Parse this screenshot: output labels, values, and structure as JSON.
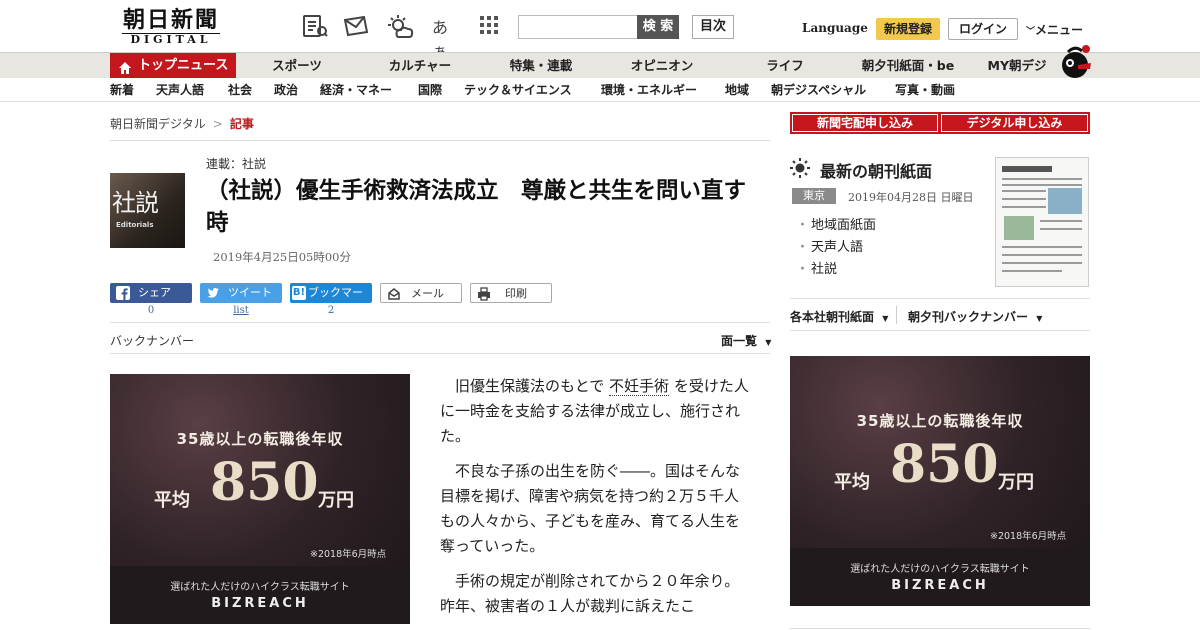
{
  "header": {
    "logo_main": "朝日新聞",
    "logo_sub": "DIGITAL",
    "icons": [
      "paper-icon",
      "mail-icon",
      "weather-icon",
      "font-size-icon",
      "grid-menu-icon"
    ],
    "font_size_label": "あぁ",
    "search_placeholder": "",
    "search_button": "検 索",
    "toc_button": "目次",
    "language": "Language",
    "register": "新規登録",
    "login": "ログイン",
    "menu": "メニュー"
  },
  "nav_main": [
    "トップニュース",
    "スポーツ",
    "カルチャー",
    "特集・連載",
    "オピニオン",
    "ライフ",
    "朝夕刊紙面・be",
    "MY朝デジ"
  ],
  "nav_sub": [
    "新着",
    "天声人語",
    "社会",
    "政治",
    "経済・マネー",
    "国際",
    "テック＆サイエンス",
    "環境・エネルギー",
    "地域",
    "朝デジスペシャル",
    "写真・動画"
  ],
  "breadcrumb": {
    "root": "朝日新聞デジタル",
    "sep": ">",
    "current": "記事"
  },
  "article": {
    "thumb_kanji": "社説",
    "thumb_en": "Editorials",
    "series": "連載：社説",
    "headline": "（社説）優生手術救済法成立　尊厳と共生を問い直す時",
    "date": "2019年4月25日05時00分",
    "share": {
      "facebook_label": "シェア",
      "facebook_count": "0",
      "twitter_label": "ツイート",
      "twitter_count": "list",
      "hatena_label": "ブックマーク",
      "hatena_count": "2",
      "mail_label": "メール",
      "print_label": "印刷"
    },
    "backnumber": "バックナンバー",
    "page_list": "面一覧",
    "body": {
      "p1_before": "旧優生保護法のもとで",
      "p1_term": "不妊手術",
      "p1_after": "を受けた人に一時金を支給する法律が成立し、施行された。",
      "p2": "不良な子孫の出生を防ぐ――。国はそんな目標を掲げ、障害や病気を持つ約２万５千人もの人々から、子どもを産み、育てる人生を奪っていった。",
      "p3": "手術の規定が削除されてから２０年余り。昨年、被害者の１人が裁判に訴えたこ"
    }
  },
  "ad": {
    "line1": "35歳以上の転職後年収",
    "avg": "平均",
    "amount": "850",
    "unit": "万円",
    "note": "※2018年6月時点",
    "tagline": "選ばれた人だけのハイクラス転職サイト",
    "brand": "BIZREACH"
  },
  "sidebar": {
    "subscribe_paper": "新聞宅配申し込み",
    "subscribe_digital": "デジタル申し込み",
    "paper_title": "最新の朝刊紙面",
    "edition": "東京",
    "edition_date": "2019年04月28日 日曜日",
    "links": [
      "地域面紙面",
      "天声人語",
      "社説"
    ],
    "menu_left": "各本社朝刊紙面",
    "menu_right": "朝夕刊バックナンバー"
  },
  "colors": {
    "brand_red": "#c4161c",
    "register_yellow": "#f2c94c",
    "nav_bg": "#e8e6e0"
  }
}
